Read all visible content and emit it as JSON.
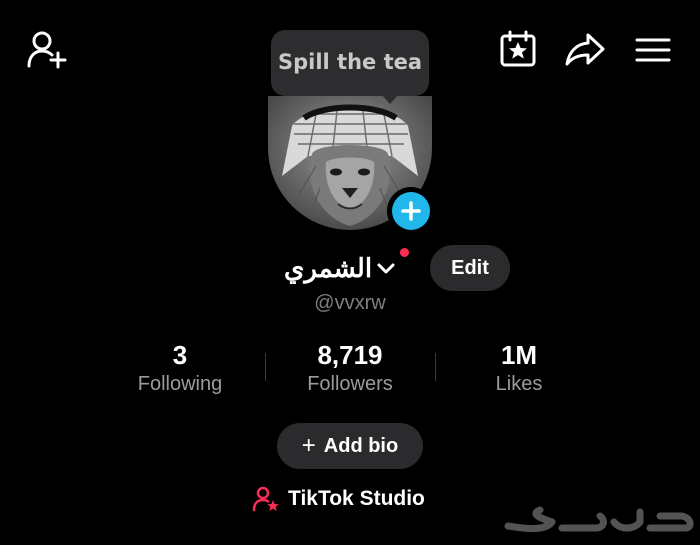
{
  "header": {
    "add_friend_icon": "person-plus-icon",
    "calendar_icon": "calendar-star-icon",
    "share_icon": "share-arrow-icon",
    "menu_icon": "hamburger-menu-icon"
  },
  "tooltip": {
    "text": "Spill the tea"
  },
  "profile": {
    "display_name": "الشمري",
    "username": "@vvxrw",
    "edit_label": "Edit"
  },
  "stats": [
    {
      "value": "3",
      "label": "Following"
    },
    {
      "value": "8,719",
      "label": "Followers"
    },
    {
      "value": "1M",
      "label": "Likes"
    }
  ],
  "bio": {
    "label": "Add bio"
  },
  "studio": {
    "label": "TikTok Studio"
  },
  "colors": {
    "background": "#000000",
    "accent_blue": "#21b7eb",
    "accent_red": "#fe2c55",
    "pill_bg": "#2b2b2d",
    "muted_text": "#9b9b9b"
  },
  "watermark": {
    "text": "حراج"
  }
}
